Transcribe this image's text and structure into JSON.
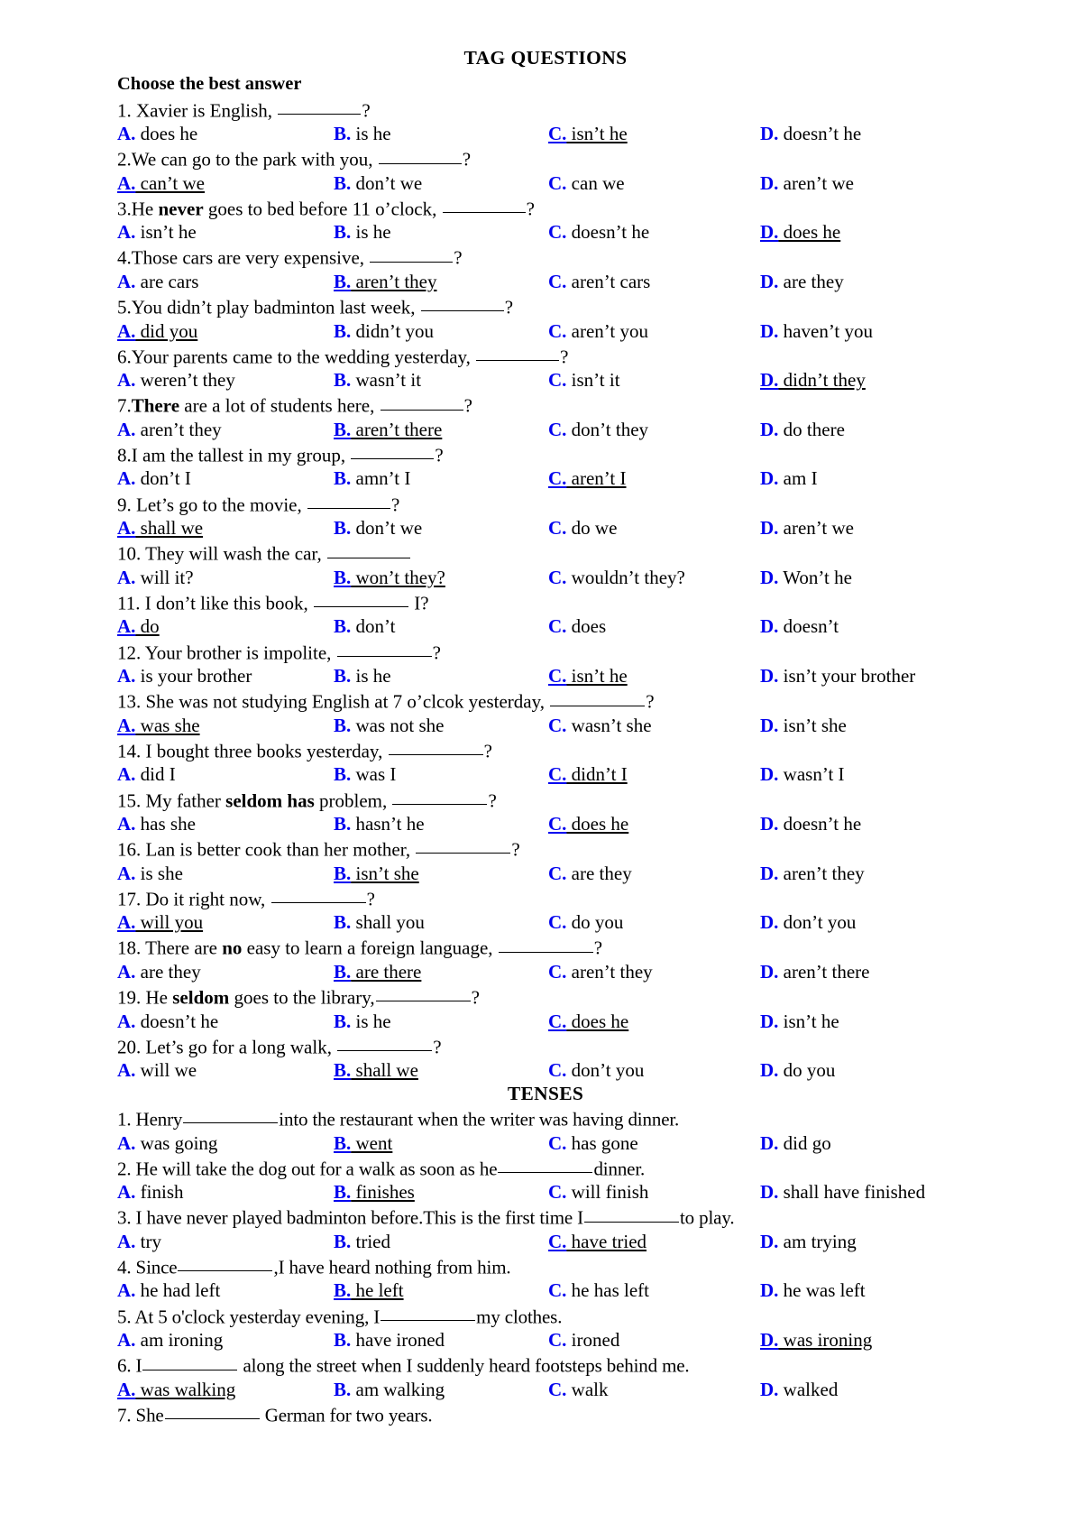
{
  "document": {
    "title": "TAG QUESTIONS",
    "instruction": "Choose the best answer",
    "second_section_title": "TENSES",
    "accent_color": "#0000EE",
    "text_color": "#000000",
    "background_color": "#FFFFFF"
  },
  "tag_questions": [
    {
      "number": "1.",
      "stem_before": " Xavier is English, ",
      "blank_width": 92,
      "stem_after": "?",
      "bold_word": "",
      "options": [
        {
          "letter": "A.",
          "text": "does he",
          "correct": false
        },
        {
          "letter": "B.",
          "text": "is he",
          "correct": false
        },
        {
          "letter": "C.",
          "text": "isn’t he",
          "correct": true
        },
        {
          "letter": "D.",
          "text": "doesn’t he",
          "correct": false
        }
      ]
    },
    {
      "number": "2.",
      "stem_before": "We can go to the park with you, ",
      "blank_width": 92,
      "stem_after": "?",
      "options": [
        {
          "letter": "A.",
          "text": "can’t we",
          "correct": true
        },
        {
          "letter": "B.",
          "text": "don’t we",
          "correct": false
        },
        {
          "letter": "C.",
          "text": "can we",
          "correct": false
        },
        {
          "letter": "D.",
          "text": "aren’t we",
          "correct": false
        }
      ]
    },
    {
      "number": "3.",
      "stem_before": "He ",
      "bold_word": "never",
      "stem_mid": " goes to bed before 11 o’clock, ",
      "blank_width": 92,
      "stem_after": "?",
      "options": [
        {
          "letter": "A.",
          "text": "isn’t he",
          "correct": false
        },
        {
          "letter": "B.",
          "text": "is he",
          "correct": false
        },
        {
          "letter": "C.",
          "text": "doesn’t he",
          "correct": false
        },
        {
          "letter": "D.",
          "text": "does he",
          "correct": true
        }
      ]
    },
    {
      "number": "4.",
      "stem_before": "Those cars are very expensive, ",
      "blank_width": 92,
      "stem_after": "?",
      "options": [
        {
          "letter": "A.",
          "text": "are cars",
          "correct": false
        },
        {
          "letter": "B.",
          "text": "aren’t they",
          "correct": true
        },
        {
          "letter": "C.",
          "text": "aren’t cars",
          "correct": false
        },
        {
          "letter": "D.",
          "text": "are they",
          "correct": false
        }
      ]
    },
    {
      "number": "5.",
      "stem_before": "You didn’t play badminton last week, ",
      "blank_width": 92,
      "stem_after": "?",
      "options": [
        {
          "letter": "A.",
          "text": "did you",
          "correct": true
        },
        {
          "letter": "B.",
          "text": "didn’t you",
          "correct": false
        },
        {
          "letter": "C.",
          "text": "aren’t you",
          "correct": false
        },
        {
          "letter": "D.",
          "text": "haven’t you",
          "correct": false
        }
      ]
    },
    {
      "number": "6.",
      "stem_before": "Your parents came to the wedding yesterday, ",
      "blank_width": 92,
      "stem_after": "?",
      "options": [
        {
          "letter": "A.",
          "text": "weren’t they",
          "correct": false
        },
        {
          "letter": "B.",
          "text": "wasn’t it",
          "correct": false
        },
        {
          "letter": "C.",
          "text": "isn’t it",
          "correct": false
        },
        {
          "letter": "D.",
          "text": "didn’t they",
          "correct": true
        }
      ]
    },
    {
      "number": "7.",
      "stem_before": "",
      "bold_word": "There",
      "stem_mid": " are a lot of students here, ",
      "blank_width": 92,
      "stem_after": "?",
      "options": [
        {
          "letter": "A.",
          "text": "aren’t they",
          "correct": false
        },
        {
          "letter": "B.",
          "text": "aren’t there",
          "correct": true
        },
        {
          "letter": "C.",
          "text": "don’t they",
          "correct": false
        },
        {
          "letter": "D.",
          "text": "do there",
          "correct": false
        }
      ]
    },
    {
      "number": "8.",
      "stem_before": "I am the tallest in my group, ",
      "blank_width": 92,
      "stem_after": "?",
      "options": [
        {
          "letter": "A.",
          "text": "don’t I",
          "correct": false
        },
        {
          "letter": "B.",
          "text": "amn’t I",
          "correct": false
        },
        {
          "letter": "C.",
          "text": "aren’t I",
          "correct": true
        },
        {
          "letter": "D.",
          "text": "am I",
          "correct": false
        }
      ]
    },
    {
      "number": "9.",
      "stem_before": " Let’s go to the movie, ",
      "blank_width": 92,
      "stem_after": "?",
      "options": [
        {
          "letter": "A.",
          "text": "shall we",
          "correct": true
        },
        {
          "letter": "B.",
          "text": "don’t we",
          "correct": false
        },
        {
          "letter": "C.",
          "text": "do we",
          "correct": false
        },
        {
          "letter": "D.",
          "text": "aren’t we",
          "correct": false
        }
      ]
    },
    {
      "number": "10.",
      "stem_before": " They will wash the car, ",
      "blank_width": 92,
      "stem_after": "",
      "options": [
        {
          "letter": "A.",
          "text": "will it?",
          "correct": false
        },
        {
          "letter": "B.",
          "text": "won’t they?",
          "correct": true
        },
        {
          "letter": "C.",
          "text": "wouldn’t they?",
          "correct": false
        },
        {
          "letter": "D.",
          "text": "Won’t he",
          "correct": false
        }
      ]
    },
    {
      "number": "11.",
      "stem_before": " I don’t like this book, ",
      "blank_width": 105,
      "stem_after": " I?",
      "options": [
        {
          "letter": "A.",
          "text": "do",
          "correct": true
        },
        {
          "letter": "B.",
          "text": "don’t",
          "correct": false
        },
        {
          "letter": "C.",
          "text": "does",
          "correct": false
        },
        {
          "letter": "D.",
          "text": "doesn’t",
          "correct": false
        }
      ]
    },
    {
      "number": "12.",
      "stem_before": " Your brother is impolite, ",
      "blank_width": 105,
      "stem_after": "?",
      "options": [
        {
          "letter": "A.",
          "text": "is your brother",
          "correct": false
        },
        {
          "letter": "B.",
          "text": "is he",
          "correct": false
        },
        {
          "letter": "C.",
          "text": "isn’t he",
          "correct": true
        },
        {
          "letter": "D.",
          "text": "isn’t your brother",
          "correct": false
        }
      ]
    },
    {
      "number": "13.",
      "stem_before": " She was not studying English at 7 o’clcok yesterday, ",
      "blank_width": 105,
      "stem_after": "?",
      "options": [
        {
          "letter": "A.",
          "text": "was she",
          "correct": true
        },
        {
          "letter": "B.",
          "text": "was not she",
          "correct": false
        },
        {
          "letter": "C.",
          "text": "wasn’t she",
          "correct": false
        },
        {
          "letter": "D.",
          "text": "isn’t she",
          "correct": false
        }
      ]
    },
    {
      "number": "14.",
      "stem_before": " I bought three books yesterday, ",
      "blank_width": 105,
      "stem_after": "?",
      "options": [
        {
          "letter": "A.",
          "text": "did I",
          "correct": false
        },
        {
          "letter": "B.",
          "text": "was I",
          "correct": false
        },
        {
          "letter": "C.",
          "text": "didn’t I",
          "correct": true
        },
        {
          "letter": "D.",
          "text": "wasn’t I",
          "correct": false
        }
      ]
    },
    {
      "number": "15.",
      "stem_before": " My father ",
      "bold_word": "seldom has",
      "stem_mid": " problem, ",
      "blank_width": 105,
      "stem_after": "?",
      "options": [
        {
          "letter": "A.",
          "text": "has she",
          "correct": false
        },
        {
          "letter": "B.",
          "text": "hasn’t he",
          "correct": false
        },
        {
          "letter": "C.",
          "text": "does he",
          "correct": true
        },
        {
          "letter": "D.",
          "text": "doesn’t he",
          "correct": false
        }
      ]
    },
    {
      "number": "16.",
      "stem_before": " Lan is better cook than her mother, ",
      "blank_width": 105,
      "stem_after": "?",
      "options": [
        {
          "letter": "A.",
          "text": "is she",
          "correct": false
        },
        {
          "letter": "B.",
          "text": "isn’t she",
          "correct": true
        },
        {
          "letter": "C.",
          "text": "are they",
          "correct": false
        },
        {
          "letter": "D.",
          "text": "aren’t they",
          "correct": false
        }
      ]
    },
    {
      "number": "17.",
      "stem_before": " Do it right now, ",
      "blank_width": 105,
      "stem_after": "?",
      "options": [
        {
          "letter": "A.",
          "text": "will you",
          "correct": true
        },
        {
          "letter": "B.",
          "text": "shall you",
          "correct": false
        },
        {
          "letter": "C.",
          "text": "do you",
          "correct": false
        },
        {
          "letter": "D.",
          "text": "don’t you",
          "correct": false
        }
      ]
    },
    {
      "number": "18.",
      "stem_before": " There are ",
      "bold_word": "no",
      "stem_mid": " easy to learn a foreign language, ",
      "blank_width": 105,
      "stem_after": "?",
      "options": [
        {
          "letter": "A.",
          "text": "are they",
          "correct": false
        },
        {
          "letter": "B.",
          "text": "are there",
          "correct": true
        },
        {
          "letter": "C.",
          "text": "aren’t they",
          "correct": false
        },
        {
          "letter": "D.",
          "text": "aren’t there",
          "correct": false
        }
      ]
    },
    {
      "number": "19.",
      "stem_before": " He ",
      "bold_word": "seldom",
      "stem_mid": " goes to the library,",
      "blank_width": 105,
      "stem_after": "?",
      "options": [
        {
          "letter": "A.",
          "text": "doesn’t he",
          "correct": false
        },
        {
          "letter": "B.",
          "text": "is he",
          "correct": false
        },
        {
          "letter": "C.",
          "text": "does he",
          "correct": true
        },
        {
          "letter": "D.",
          "text": "isn’t he",
          "correct": false
        }
      ]
    },
    {
      "number": "20.",
      "stem_before": " Let’s go for a long walk, ",
      "blank_width": 105,
      "stem_after": "?",
      "options": [
        {
          "letter": "A.",
          "text": "will we",
          "correct": false
        },
        {
          "letter": "B.",
          "text": "shall we",
          "correct": true
        },
        {
          "letter": "C.",
          "text": "don’t you",
          "correct": false
        },
        {
          "letter": "D.",
          "text": "do you",
          "correct": false
        }
      ]
    }
  ],
  "tenses_questions": [
    {
      "number": "1.",
      "stem_before": " Henry",
      "blank_width": 105,
      "stem_after": "into the restaurant when the writer was having dinner.",
      "options": [
        {
          "letter": "A.",
          "text": "was going",
          "correct": false
        },
        {
          "letter": "B.",
          "text": "went",
          "correct": true
        },
        {
          "letter": "C.",
          "text": "has gone",
          "correct": false
        },
        {
          "letter": "D.",
          "text": "did go",
          "correct": false
        }
      ]
    },
    {
      "number": "2.",
      "stem_before": " He will take the dog out for a walk as soon as he",
      "blank_width": 105,
      "stem_after": "dinner.",
      "options": [
        {
          "letter": "A.",
          "text": "finish",
          "correct": false
        },
        {
          "letter": "B.",
          "text": "finishes",
          "correct": true
        },
        {
          "letter": "C.",
          "text": "will finish",
          "correct": false
        },
        {
          "letter": "D.",
          "text": "shall have finished",
          "correct": false
        }
      ]
    },
    {
      "number": "3.",
      "stem_before": " I have never played badminton before.This is the first time I",
      "blank_width": 105,
      "stem_after": "to play.",
      "options": [
        {
          "letter": "A.",
          "text": "try",
          "correct": false
        },
        {
          "letter": "B.",
          "text": "tried",
          "correct": false
        },
        {
          "letter": "C.",
          "text": "have tried",
          "correct": true
        },
        {
          "letter": "D.",
          "text": "am trying",
          "correct": false
        }
      ]
    },
    {
      "number": "4.",
      "stem_before": " Since",
      "blank_width": 105,
      "stem_after": ",I have heard nothing from him.",
      "options": [
        {
          "letter": "A.",
          "text": "he had left",
          "correct": false
        },
        {
          "letter": "B.",
          "text": "he left",
          "correct": true
        },
        {
          "letter": "C.",
          "text": "he has left",
          "correct": false
        },
        {
          "letter": "D.",
          "text": "he was left",
          "correct": false
        }
      ]
    },
    {
      "number": "5.",
      "stem_before": " At 5 o'clock yesterday evening, I",
      "blank_width": 105,
      "stem_after": "my clothes.",
      "options": [
        {
          "letter": "A.",
          "text": "am ironing",
          "correct": false
        },
        {
          "letter": "B.",
          "text": "have ironed",
          "correct": false
        },
        {
          "letter": "C.",
          "text": "ironed",
          "correct": false
        },
        {
          "letter": "D.",
          "text": "was ironing",
          "correct": true
        }
      ]
    },
    {
      "number": "6.",
      "stem_before": " I",
      "blank_width": 105,
      "stem_after": " along the street when I suddenly heard footsteps behind me.",
      "options": [
        {
          "letter": "A.",
          "text": "was walking",
          "correct": true
        },
        {
          "letter": "B.",
          "text": "am walking",
          "correct": false
        },
        {
          "letter": "C.",
          "text": "walk",
          "correct": false
        },
        {
          "letter": "D.",
          "text": "walked",
          "correct": false
        }
      ]
    },
    {
      "number": "7.",
      "stem_before": " She",
      "blank_width": 105,
      "stem_after": " German for two years.",
      "options": []
    }
  ]
}
